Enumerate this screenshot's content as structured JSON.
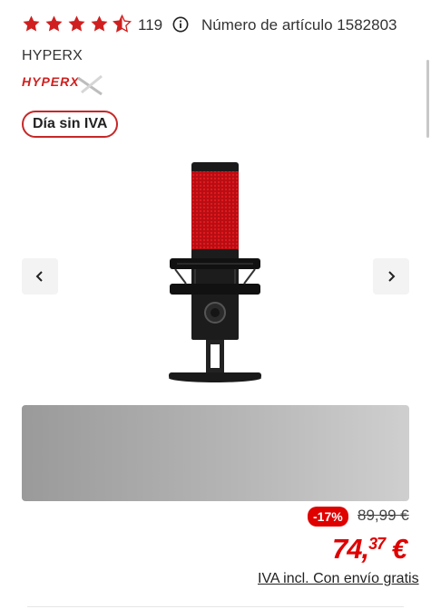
{
  "rating": {
    "value": 4.5,
    "max": 5,
    "count": "119"
  },
  "article": {
    "text": "Número de artículo 1582803"
  },
  "brand": {
    "name": "HYPERX",
    "logo_text": "HYPERX"
  },
  "badge": {
    "label": "Día sin IVA"
  },
  "gallery": {
    "prev_icon": "chevron-left-icon",
    "next_icon": "chevron-right-icon"
  },
  "pricing": {
    "discount": "-17%",
    "old_price": "89,99 €",
    "price_main": "74,",
    "price_cents": "37",
    "currency": " €",
    "vat_text": "IVA incl. Con envío gratis"
  },
  "colors": {
    "accent": "#df0000",
    "star": "#d01f1f",
    "badge_border": "#c62828"
  }
}
